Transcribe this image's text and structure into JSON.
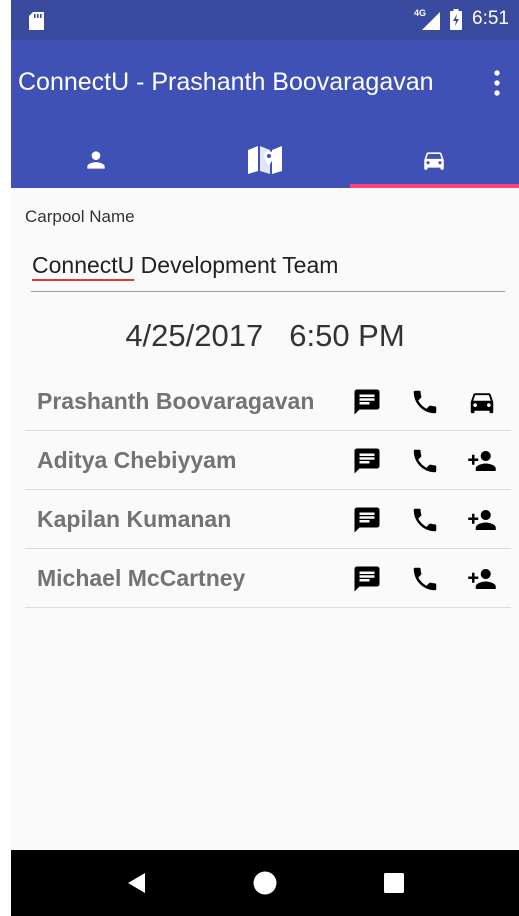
{
  "status_bar": {
    "network": "4G",
    "time": "6:51"
  },
  "app_bar": {
    "title": "ConnectU - Prashanth Boovaragavan"
  },
  "tabs": [
    {
      "icon": "person-icon",
      "active": false
    },
    {
      "icon": "map-icon",
      "active": false
    },
    {
      "icon": "car-icon",
      "active": true
    }
  ],
  "carpool": {
    "label": "Carpool Name",
    "name_misspelled": "ConnectU",
    "name_rest": " Development Team",
    "date": "4/25/2017",
    "time": "6:50 PM"
  },
  "members": [
    {
      "name": "Prashanth Boovaragavan",
      "action_icon": "car-icon"
    },
    {
      "name": "Aditya Chebiyyam",
      "action_icon": "add-person-icon"
    },
    {
      "name": "Kapilan Kumanan",
      "action_icon": "add-person-icon"
    },
    {
      "name": "Michael McCartney",
      "action_icon": "add-person-icon"
    }
  ],
  "colors": {
    "primary": "#3f51b5",
    "status_bar": "#3a4a9f",
    "accent": "#ff4081"
  }
}
